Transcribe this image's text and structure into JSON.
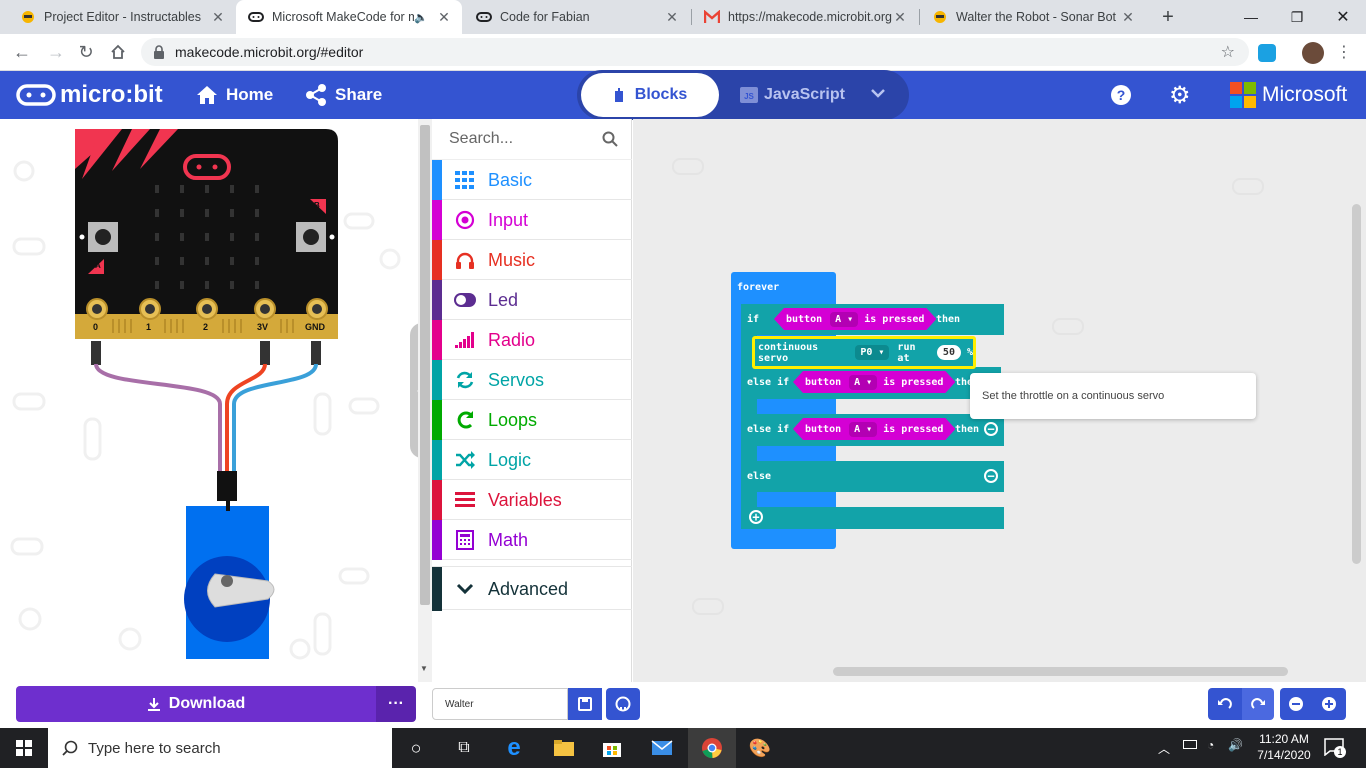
{
  "browser": {
    "tabs": [
      {
        "title": "Project Editor - Instructables",
        "icon": "instructables-robot-icon"
      },
      {
        "title": "Microsoft MakeCode for m",
        "icon": "makecode-icon",
        "active": true
      },
      {
        "title": "Code for Fabian",
        "icon": "makecode-icon"
      },
      {
        "title": "https://makecode.microbit.org",
        "icon": "gmail-icon"
      },
      {
        "title": "Walter the Robot - Sonar Bot -",
        "icon": "instructables-robot-icon"
      }
    ],
    "url": "makecode.microbit.org/#editor"
  },
  "header": {
    "logo": "micro:bit",
    "home_label": "Home",
    "share_label": "Share",
    "blocks_label": "Blocks",
    "javascript_label": "JavaScript",
    "microsoft_label": "Microsoft"
  },
  "simulator": {
    "button_a": "A",
    "button_b": "B",
    "pins": [
      "0",
      "1",
      "2",
      "3V",
      "GND"
    ]
  },
  "toolbox": {
    "search_placeholder": "Search...",
    "categories": [
      {
        "label": "Basic",
        "color": "#1e90ff"
      },
      {
        "label": "Input",
        "color": "#d400d4"
      },
      {
        "label": "Music",
        "color": "#e63022"
      },
      {
        "label": "Led",
        "color": "#5c2d91"
      },
      {
        "label": "Radio",
        "color": "#e3008c"
      },
      {
        "label": "Servos",
        "color": "#00a4a6"
      },
      {
        "label": "Loops",
        "color": "#00aa00"
      },
      {
        "label": "Logic",
        "color": "#00a4a6"
      },
      {
        "label": "Variables",
        "color": "#dc143c"
      },
      {
        "label": "Math",
        "color": "#9400d3"
      }
    ],
    "advanced_label": "Advanced"
  },
  "workspace": {
    "forever": "forever",
    "if": "if",
    "then": "then",
    "else_if": "else if",
    "else": "else",
    "button": "button",
    "button_value": "A",
    "is_pressed": "is pressed",
    "servo_prefix": "continuous servo",
    "servo_pin": "P0",
    "run_at": "run at",
    "run_value": "50",
    "percent": "%",
    "tooltip": "Set the throttle on a continuous servo"
  },
  "bottom": {
    "download_label": "Download",
    "project_name": "Walter"
  },
  "taskbar": {
    "search_placeholder": "Type here to search",
    "time": "11:20 AM",
    "date": "7/14/2020",
    "notification_count": "1"
  }
}
